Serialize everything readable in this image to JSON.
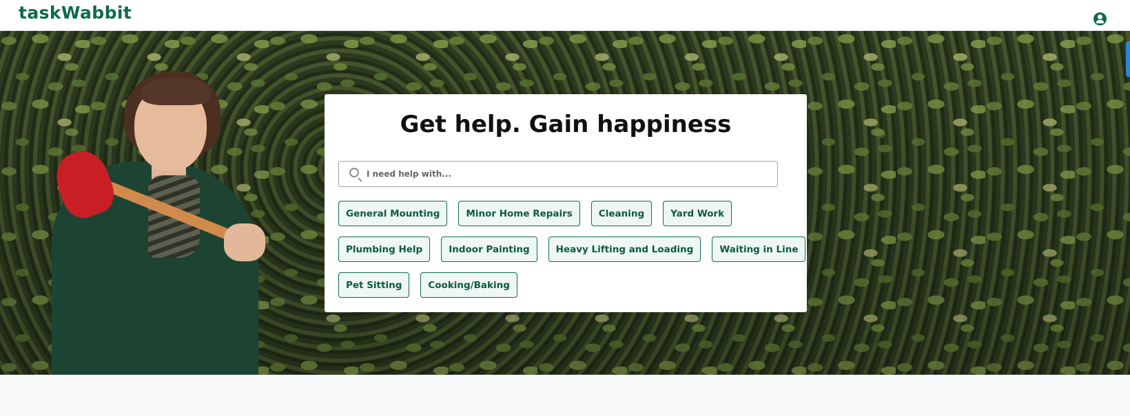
{
  "header": {
    "logo": "taskWabbit",
    "account_icon": "user-circle-icon"
  },
  "hero": {
    "headline": "Get help. Gain happiness",
    "search": {
      "placeholder": "I need help with...",
      "value": "",
      "icon": "search-icon"
    },
    "categories": [
      [
        "General Mounting",
        "Minor Home Repairs",
        "Cleaning",
        "Yard Work"
      ],
      [
        "Plumbing Help",
        "Indoor Painting",
        "Heavy Lifting and Loading",
        "Waiting in Line"
      ],
      [
        "Pet Sitting",
        "Cooking/Baking"
      ]
    ]
  },
  "colors": {
    "brand": "#0d6b4a",
    "chip_bg": "#eef7f4",
    "accent_tab": "#1e88e5"
  }
}
